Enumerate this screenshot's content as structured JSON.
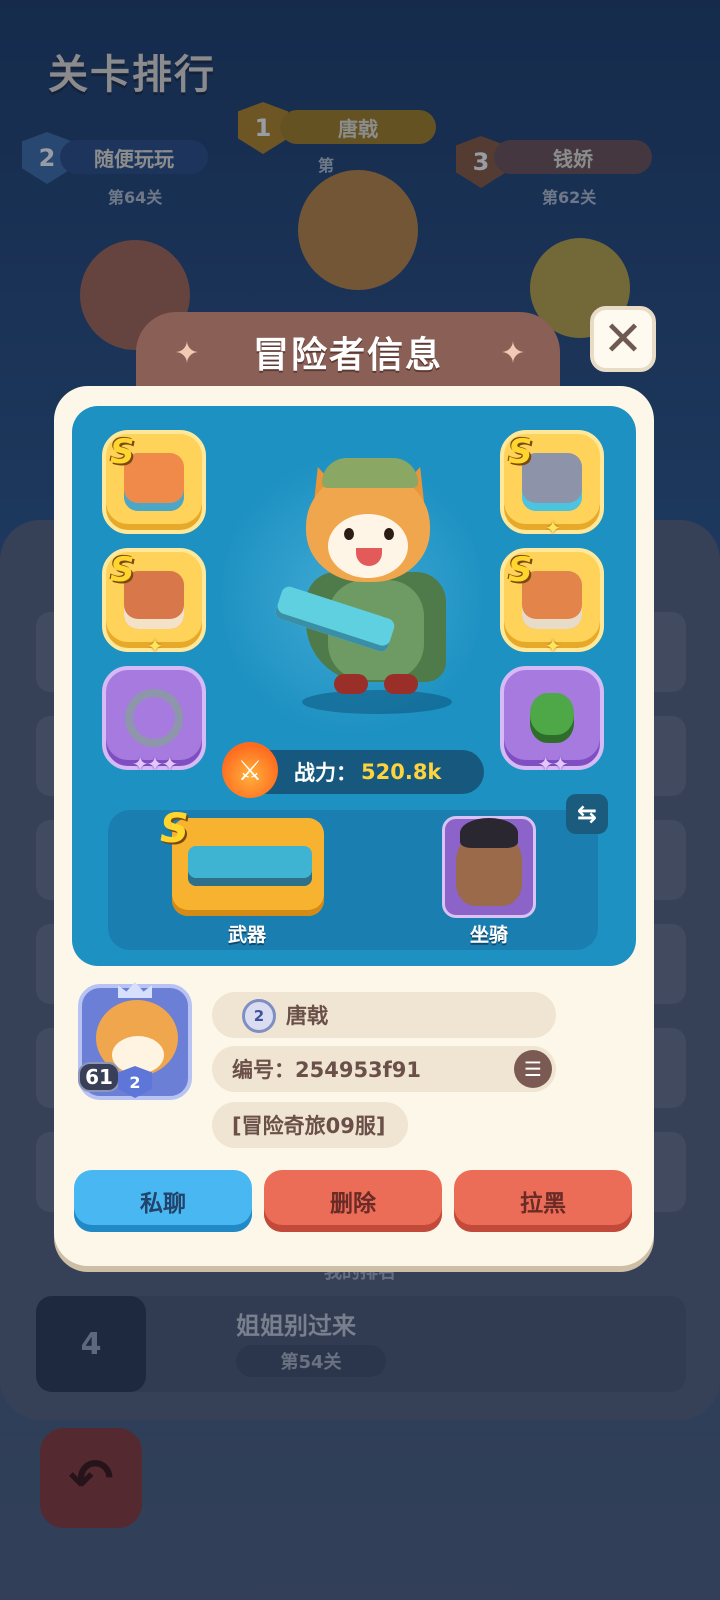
{
  "background": {
    "title": "关卡排行",
    "podium": [
      {
        "rank": "2",
        "name": "随便玩玩",
        "level": "第64关"
      },
      {
        "rank": "1",
        "name": "唐戟",
        "level": "第"
      },
      {
        "rank": "3",
        "name": "钱娇",
        "level": "第62关"
      }
    ],
    "my_rank_label": "我的排名",
    "my_rank": {
      "rank": "4",
      "name": "姐姐别过来",
      "level": "第54关"
    }
  },
  "dialog": {
    "title": "冒险者信息",
    "close_icon": "close-icon",
    "gear_slots": {
      "left": [
        {
          "icon": "blaster-gear-icon",
          "grade": "S",
          "stars": ""
        },
        {
          "icon": "armor-gear-icon",
          "grade": "S",
          "stars": "✦"
        },
        {
          "icon": "ring-gear-icon",
          "grade": "",
          "stars": "✦✦✦"
        }
      ],
      "right": [
        {
          "icon": "mech-gear-icon",
          "grade": "S",
          "stars": "✦"
        },
        {
          "icon": "boots-gear-icon",
          "grade": "S",
          "stars": "✦"
        },
        {
          "icon": "amulet-gear-icon",
          "grade": "",
          "stars": "✦✦"
        }
      ]
    },
    "power": {
      "label": "战力：",
      "value": "520.8k"
    },
    "weapon": {
      "grade": "S",
      "label": "武器"
    },
    "mount": {
      "label": "坐骑"
    },
    "player": {
      "level": "61",
      "tier": "2",
      "name": "唐戟",
      "id_text": "编号：254953f91",
      "server": "[冒险奇旅09服]"
    },
    "buttons": {
      "chat": "私聊",
      "delete": "删除",
      "block": "拉黑"
    }
  },
  "colors": {
    "dialog_bg": "#fdf7ea",
    "hero_panel": "#1d91c2",
    "power_value": "#ffd33d",
    "chat_button": "#49b8f2",
    "danger_button": "#ec6d57"
  }
}
